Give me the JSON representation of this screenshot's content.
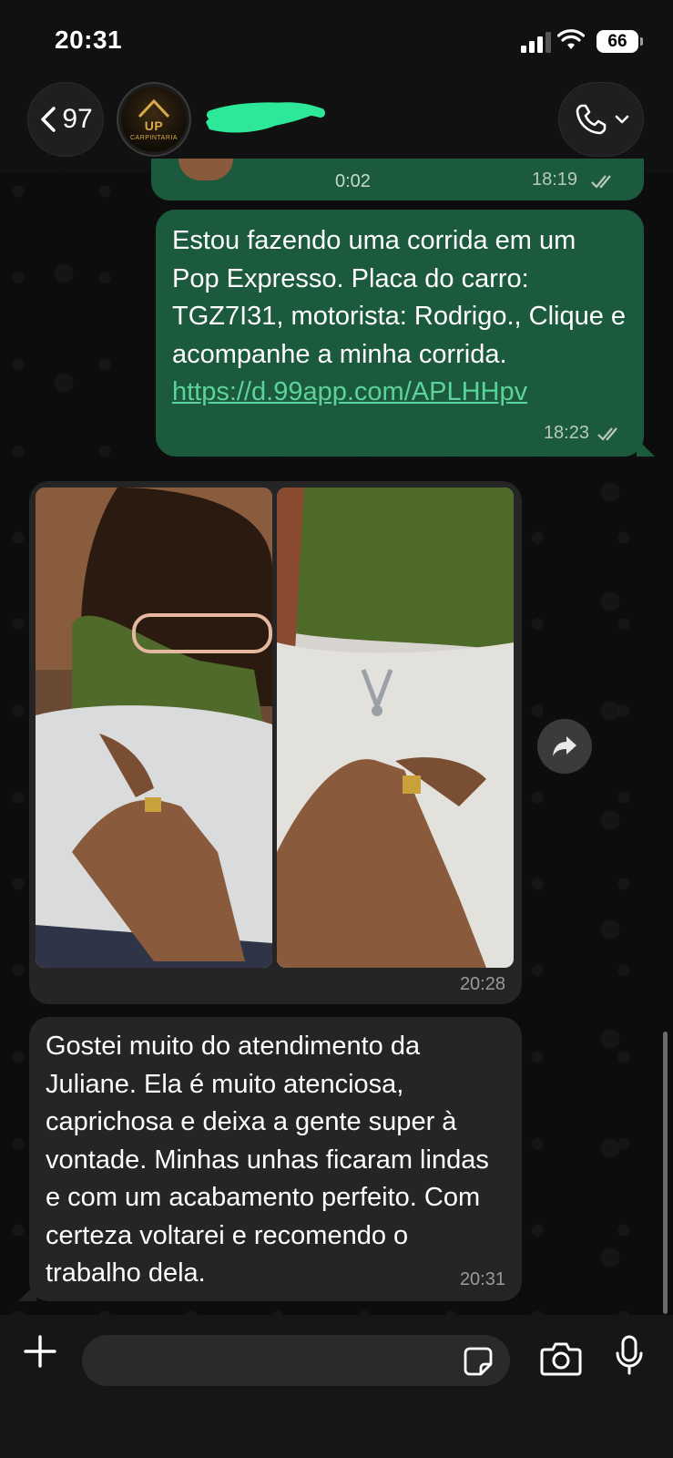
{
  "status_bar": {
    "time": "20:31",
    "battery": "66",
    "signal_bars": 3
  },
  "header": {
    "back_count": "97",
    "avatar_logo": {
      "mark": "UP",
      "sub": "CARPINTARIA"
    },
    "contact_name_redacted": true,
    "accent_color": "#2ee89a"
  },
  "messages": {
    "audio": {
      "duration": "0:02",
      "time": "18:19",
      "status": "read"
    },
    "ride": {
      "text_before_link": "Estou fazendo uma corrida em um Pop Expresso. Placa do carro: TGZ7I31, motorista: Rodrigo., Clique e acompanhe a minha corrida. ",
      "link": "https://d.99app.com/APLHHpv",
      "time": "18:23",
      "status": "read"
    },
    "photos": {
      "count": 2,
      "time": "20:28"
    },
    "review": {
      "text": "Gostei muito do atendimento da Juliane. Ela é muito atenciosa, caprichosa e deixa a gente super à vontade. Minhas unhas ficaram lindas e com um acabamento perfeito. Com certeza voltarei e recomendo o trabalho dela.",
      "time": "20:31"
    }
  },
  "composer": {
    "placeholder": ""
  },
  "colors": {
    "outgoing_bubble": "#1c5a3d",
    "incoming_bubble": "#252525",
    "link": "#5cd39a"
  }
}
